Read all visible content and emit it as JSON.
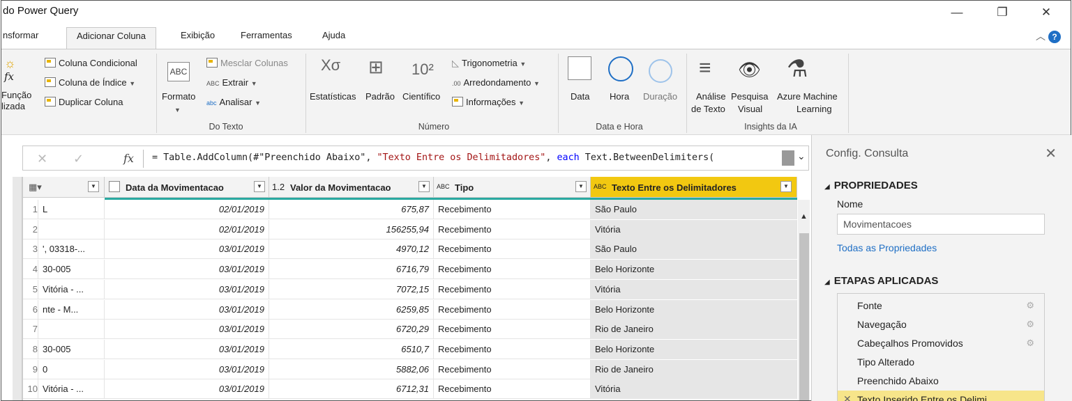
{
  "window": {
    "title": "do Power Query",
    "minimize": "—",
    "restore": "❐",
    "close": "✕"
  },
  "tabs": [
    {
      "label": "nsformar"
    },
    {
      "label": "Adicionar Coluna"
    },
    {
      "label": "Exibição"
    },
    {
      "label": "Ferramentas"
    },
    {
      "label": "Ajuda"
    }
  ],
  "ribbon": {
    "general": {
      "funcao_label1": "Função",
      "funcao_label2": "lizada",
      "coluna_condicional": "Coluna Condicional",
      "coluna_indice": "Coluna de Índice",
      "duplicar_coluna": "Duplicar Coluna"
    },
    "texto": {
      "formato": "Formato",
      "mesclar": "Mesclar Colunas",
      "extrair": "Extrair",
      "analisar": "Analisar",
      "group": "Do Texto"
    },
    "numero": {
      "estatisticas": "Estatísticas",
      "padrao": "Padrão",
      "cientifico": "Científico",
      "trigonometria": "Trigonometria",
      "arredondamento": "Arredondamento",
      "informacoes": "Informações",
      "group": "Número"
    },
    "datahora": {
      "data": "Data",
      "hora": "Hora",
      "duracao": "Duração",
      "group": "Data e Hora"
    },
    "ia": {
      "analise1": "Análise",
      "analise2": "de Texto",
      "pesquisa1": "Pesquisa",
      "pesquisa2": "Visual",
      "azure1": "Azure Machine",
      "azure2": "Learning",
      "group": "Insights da IA"
    }
  },
  "formula": {
    "prefix": "= Table.AddColumn(#",
    "arg1": "\"Preenchido Abaixo\"",
    "comma1": ", ",
    "arg2": "\"Texto Entre os Delimitadores\"",
    "comma2": ", ",
    "kw": "each",
    "rest": " Text.BetweenDelimiters("
  },
  "grid": {
    "headers": {
      "data": "Data da Movimentacao",
      "valor": "Valor da Movimentacao",
      "tipo": "Tipo",
      "texto": "Texto Entre os Delimitadores",
      "valor_type": "1.2",
      "tipo_type": "ABC",
      "texto_type": "ABC"
    },
    "rows": [
      {
        "n": "1",
        "a": "L",
        "data": "02/01/2019",
        "valor": "675,87",
        "tipo": "Recebimento",
        "texto": "São Paulo"
      },
      {
        "n": "2",
        "a": "",
        "data": "02/01/2019",
        "valor": "156255,94",
        "tipo": "Recebimento",
        "texto": "Vitória"
      },
      {
        "n": "3",
        "a": "', 03318-...",
        "data": "03/01/2019",
        "valor": "4970,12",
        "tipo": "Recebimento",
        "texto": "São Paulo"
      },
      {
        "n": "4",
        "a": "30-005",
        "data": "03/01/2019",
        "valor": "6716,79",
        "tipo": "Recebimento",
        "texto": "Belo Horizonte"
      },
      {
        "n": "5",
        "a": "Vitória - ...",
        "data": "03/01/2019",
        "valor": "7072,15",
        "tipo": "Recebimento",
        "texto": "Vitória"
      },
      {
        "n": "6",
        "a": "nte - M...",
        "data": "03/01/2019",
        "valor": "6259,85",
        "tipo": "Recebimento",
        "texto": "Belo Horizonte"
      },
      {
        "n": "7",
        "a": "",
        "data": "03/01/2019",
        "valor": "6720,29",
        "tipo": "Recebimento",
        "texto": "Rio de Janeiro"
      },
      {
        "n": "8",
        "a": "30-005",
        "data": "03/01/2019",
        "valor": "6510,7",
        "tipo": "Recebimento",
        "texto": "Belo Horizonte"
      },
      {
        "n": "9",
        "a": "0",
        "data": "03/01/2019",
        "valor": "5882,06",
        "tipo": "Recebimento",
        "texto": "Rio de Janeiro"
      },
      {
        "n": "10",
        "a": "Vitória - ...",
        "data": "03/01/2019",
        "valor": "6712,31",
        "tipo": "Recebimento",
        "texto": "Vitória"
      }
    ]
  },
  "pane": {
    "title": "Config. Consulta",
    "propriedades": "PROPRIEDADES",
    "nome_label": "Nome",
    "nome_value": "Movimentacoes",
    "todas": "Todas as Propriedades",
    "etapas": "ETAPAS APLICADAS",
    "steps": [
      {
        "label": "Fonte"
      },
      {
        "label": "Navegação"
      },
      {
        "label": "Cabeçalhos Promovidos"
      },
      {
        "label": "Tipo Alterado"
      },
      {
        "label": "Preenchido Abaixo"
      },
      {
        "label": "Texto Inserido Entre os Delimi..."
      }
    ]
  }
}
